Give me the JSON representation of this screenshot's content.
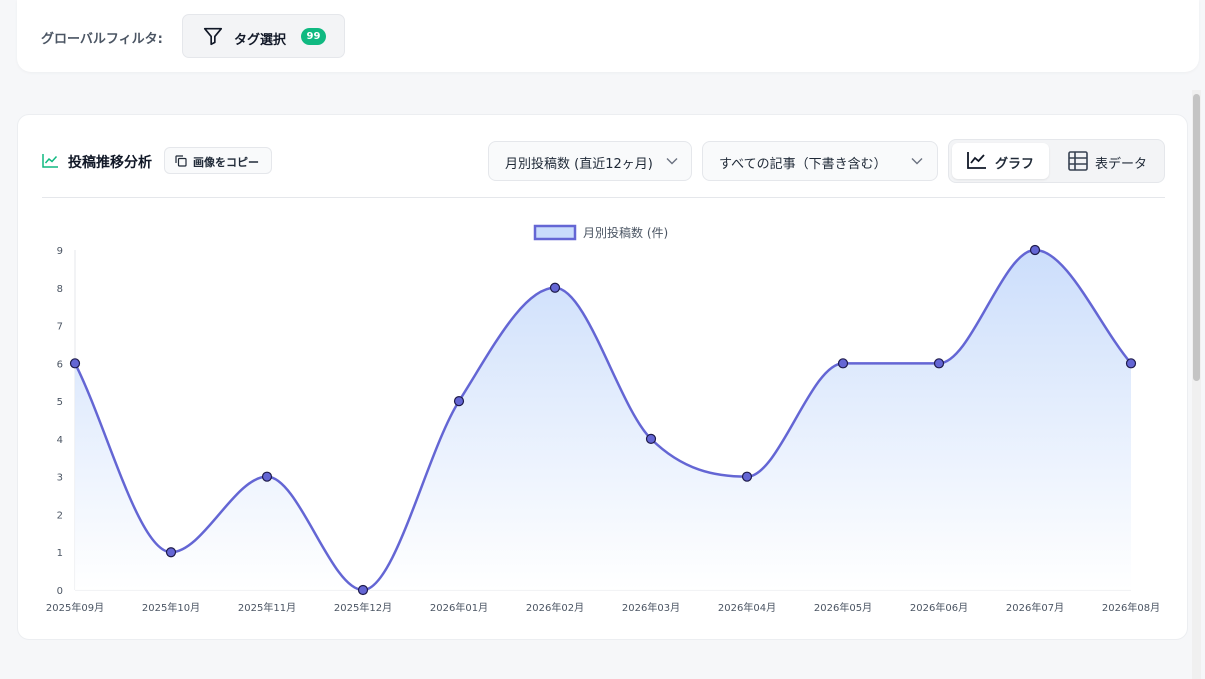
{
  "global_filter": {
    "label": "グローバルフィルタ:",
    "tag_button_label": "タグ選択",
    "tag_count": "99"
  },
  "panel": {
    "title": "投稿推移分析",
    "copy_image_label": "画像をコピー",
    "period_select": "月別投稿数 (直近12ヶ月)",
    "scope_select": "すべての記事（下書き含む）",
    "view_graph_label": "グラフ",
    "view_table_label": "表データ",
    "active_view": "graph"
  },
  "colors": {
    "accent": "#6466d4",
    "fill_top": "#c9dcfb",
    "badge": "#10b981"
  },
  "chart_data": {
    "type": "line",
    "categories": [
      "2025年09月",
      "2025年10月",
      "2025年11月",
      "2025年12月",
      "2026年01月",
      "2026年02月",
      "2026年03月",
      "2026年04月",
      "2026年05月",
      "2026年06月",
      "2026年07月",
      "2026年08月"
    ],
    "series": [
      {
        "name": "月別投稿数 (件)",
        "values": [
          6,
          1,
          3,
          0,
          5,
          8,
          4,
          3,
          6,
          6,
          9,
          6
        ]
      }
    ],
    "yticks": [
      "0",
      "1",
      "2",
      "3",
      "4",
      "5",
      "6",
      "7",
      "8",
      "9"
    ],
    "ylim": [
      0,
      9
    ],
    "area_fill": true,
    "smooth": true,
    "legend_position": "top-center",
    "grid": false
  }
}
